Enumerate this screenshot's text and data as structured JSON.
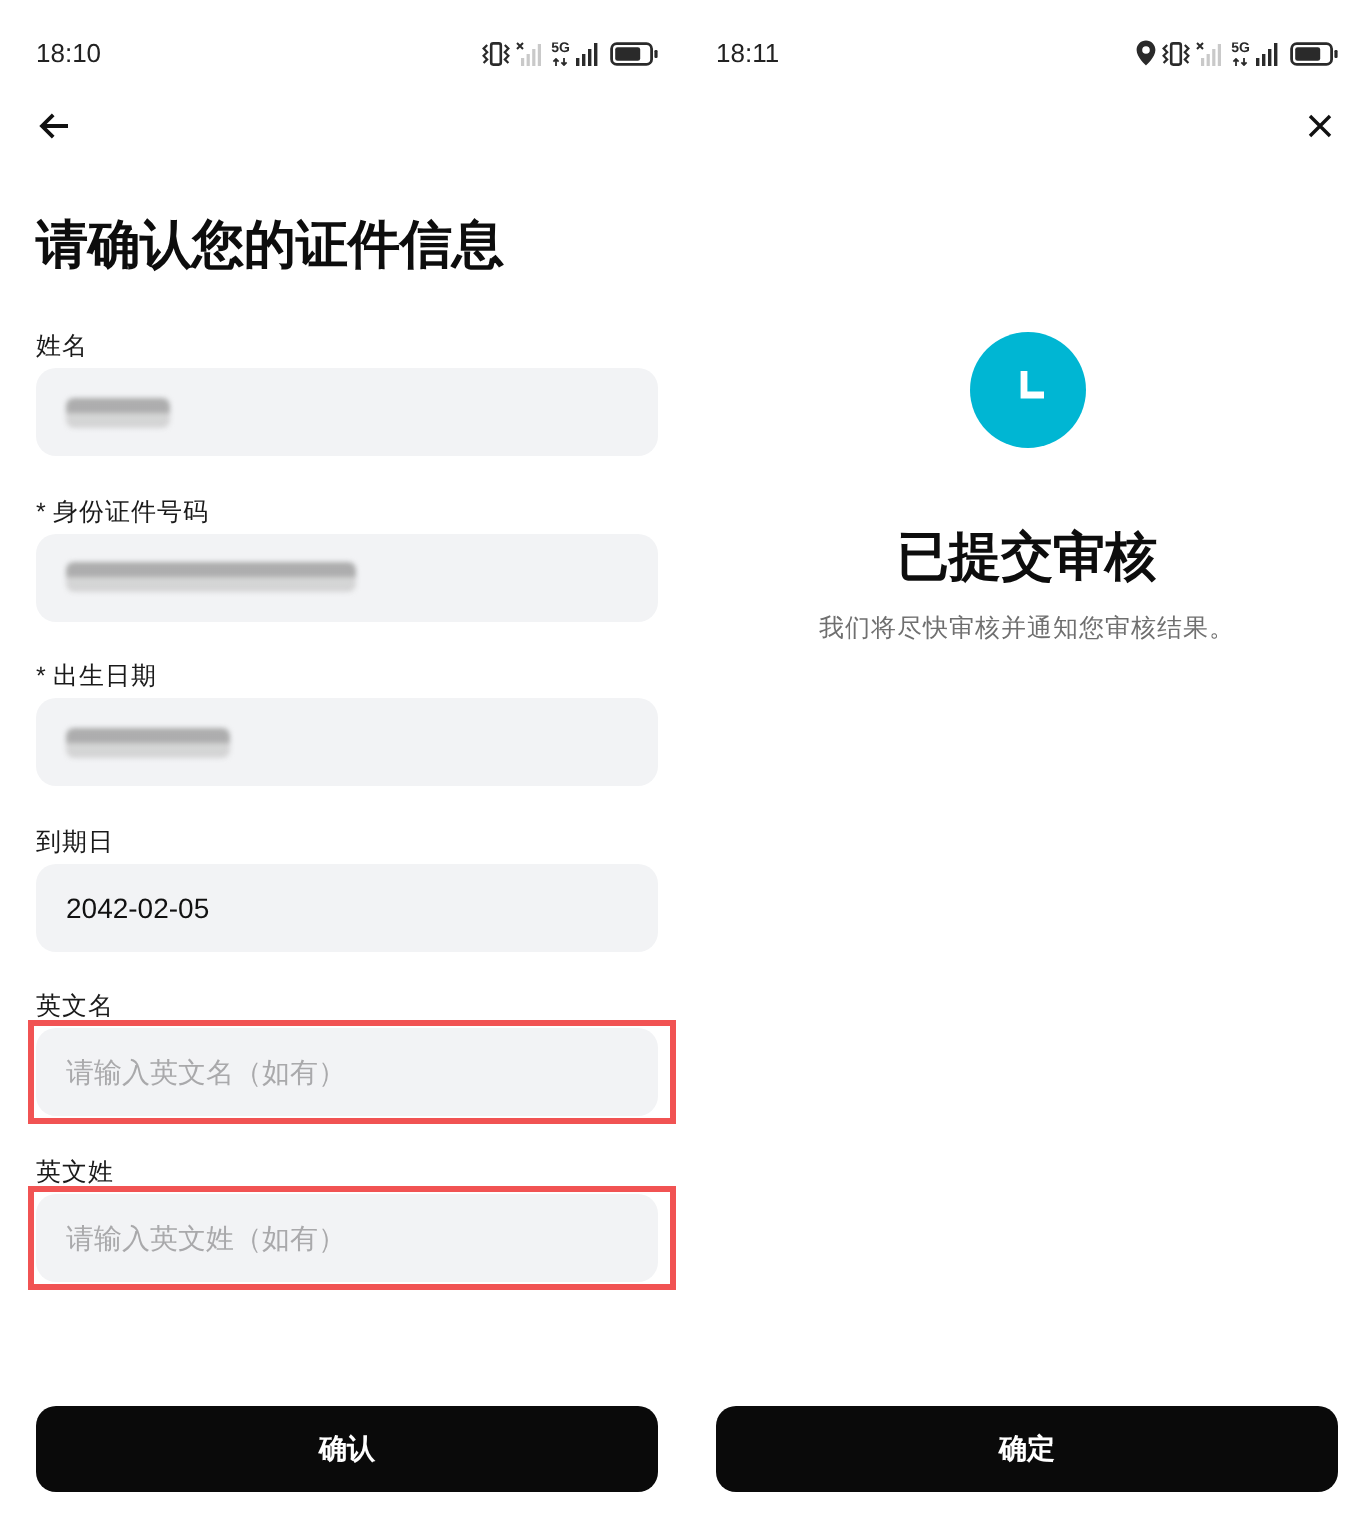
{
  "screens": [
    {
      "kind": "form",
      "status_bar": {
        "time": "18:10",
        "network": "5G",
        "location": false
      },
      "nav": {
        "kind": "back"
      },
      "title": "请确认您的证件信息",
      "fields": [
        {
          "label": "姓名",
          "redacted": true,
          "highlighted": false
        },
        {
          "label": "* 身份证件号码",
          "redacted": true,
          "highlighted": false
        },
        {
          "label": "* 出生日期",
          "redacted": true,
          "highlighted": false
        },
        {
          "label": "到期日",
          "redacted": false,
          "value": "2042-02-05",
          "highlighted": false
        },
        {
          "label": "英文名",
          "redacted": false,
          "placeholder": "请输入英文名（如有）",
          "highlighted": true
        },
        {
          "label": "英文姓",
          "redacted": false,
          "placeholder": "请输入英文姓（如有）",
          "highlighted": true
        }
      ],
      "button": "确认"
    },
    {
      "kind": "result",
      "status_bar": {
        "time": "18:11",
        "network": "5G",
        "location": true
      },
      "nav": {
        "kind": "close"
      },
      "title": "已提交审核",
      "message": "我们将尽快审核并通知您审核结果。",
      "button": "确定"
    }
  ]
}
